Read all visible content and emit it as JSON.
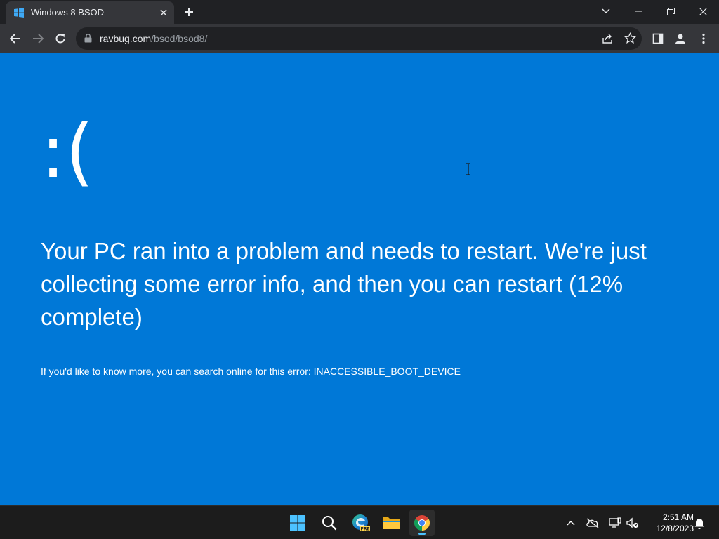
{
  "browser": {
    "tab": {
      "title": "Windows 8 BSOD"
    },
    "address": {
      "host": "ravbug.com",
      "path": "/bsod/bsod8/"
    }
  },
  "bsod": {
    "face": ":(",
    "message": "Your PC ran into a problem and needs to restart. We're just collecting some error info, and then you can restart (12% complete)",
    "more_info": "If you'd like to know more, you can search online for this error: INACCESSIBLE_BOOT_DEVICE",
    "progress_percent": 12,
    "background_color": "#0078d7"
  },
  "taskbar": {
    "apps": [
      "start-icon",
      "search-icon",
      "edge-preview-icon",
      "file-explorer-icon",
      "chrome-icon"
    ],
    "edge_badge": "PRE",
    "clock": {
      "time": "2:51 AM",
      "date": "12/8/2023"
    }
  }
}
